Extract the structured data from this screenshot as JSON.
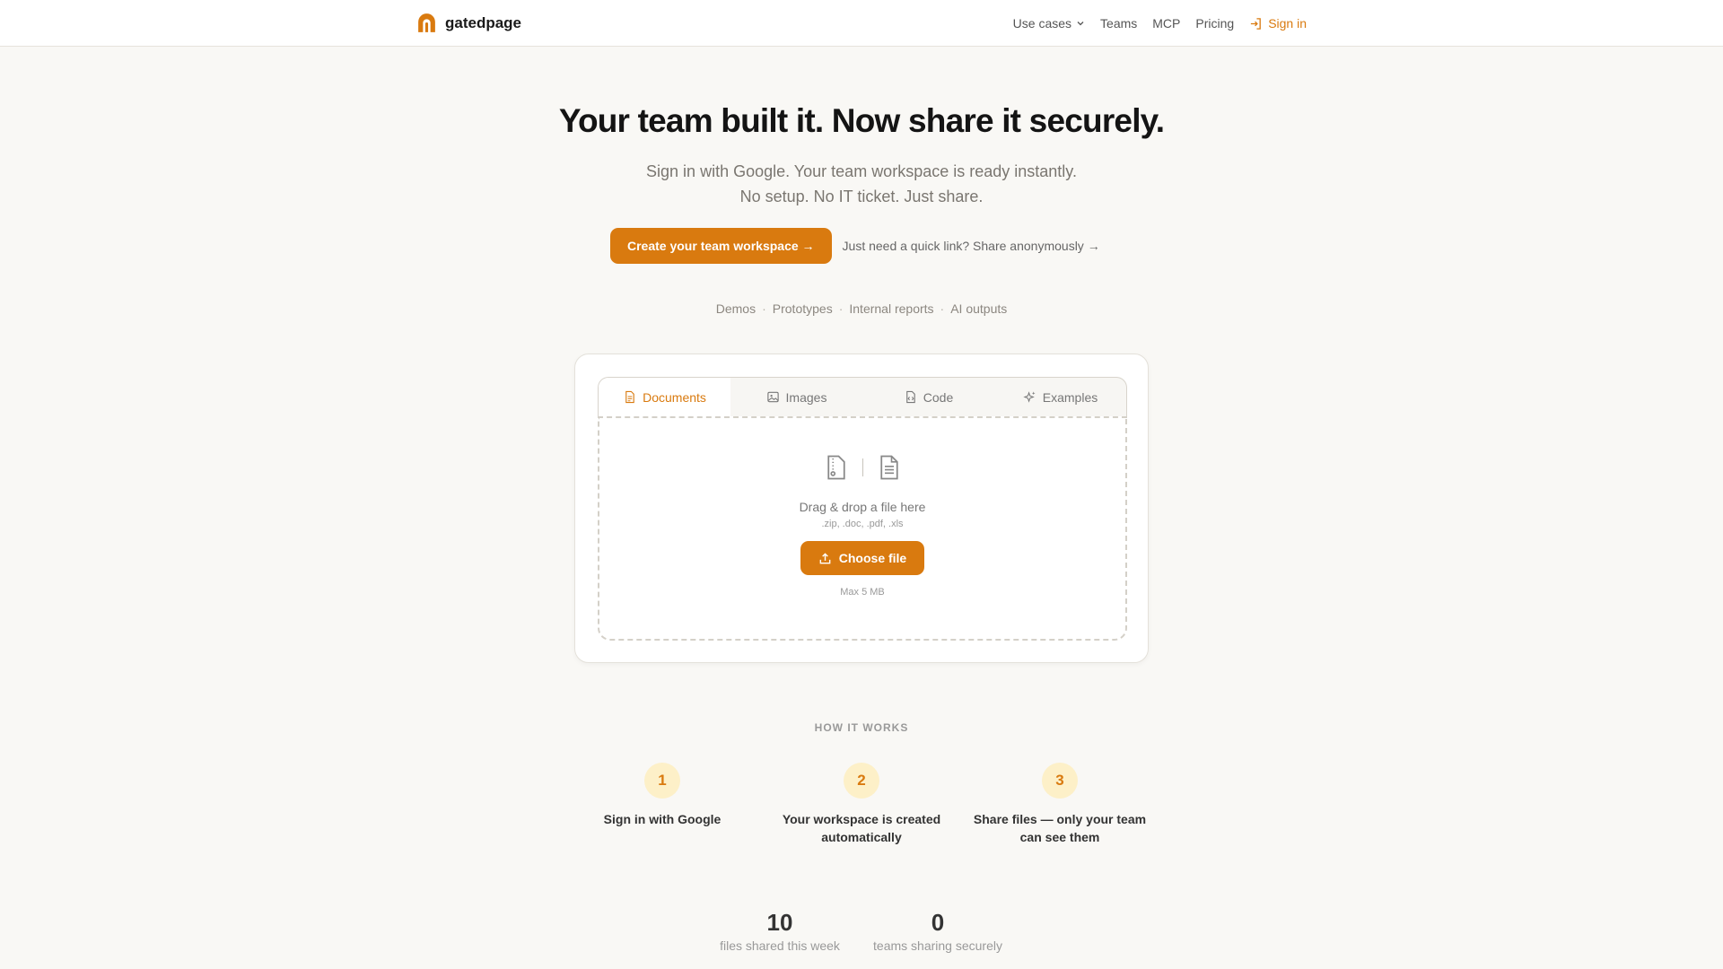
{
  "brand": {
    "name": "gatedpage"
  },
  "nav": {
    "use_cases": "Use cases",
    "teams": "Teams",
    "mcp": "MCP",
    "pricing": "Pricing",
    "sign_in": "Sign in"
  },
  "hero": {
    "title": "Your team built it. Now share it securely.",
    "subtitle_1": "Sign in with Google. Your team workspace is ready instantly.",
    "subtitle_2": "No setup. No IT ticket. Just share.",
    "cta_primary": "Create your team workspace →",
    "cta_secondary": "Just need a quick link? Share anonymously →",
    "tags": [
      "Demos",
      "Prototypes",
      "Internal reports",
      "AI outputs"
    ]
  },
  "upload": {
    "tabs": [
      {
        "label": "Documents",
        "icon": "document-icon",
        "active": true
      },
      {
        "label": "Images",
        "icon": "image-icon",
        "active": false
      },
      {
        "label": "Code",
        "icon": "code-file-icon",
        "active": false
      },
      {
        "label": "Examples",
        "icon": "sparkles-icon",
        "active": false
      }
    ],
    "drop_text": "Drag & drop a file here",
    "file_types": ".zip, .doc, .pdf, .xls",
    "choose_label": "Choose file",
    "max_size": "Max 5 MB"
  },
  "how": {
    "title": "HOW IT WORKS",
    "steps": [
      {
        "num": "1",
        "text": "Sign in with Google"
      },
      {
        "num": "2",
        "text": "Your workspace is created automatically"
      },
      {
        "num": "3",
        "text": "Share files — only your team can see them"
      }
    ]
  },
  "stats": [
    {
      "value": "10",
      "label": "files shared this week"
    },
    {
      "value": "0",
      "label": "teams sharing securely"
    }
  ],
  "colors": {
    "accent": "#d97a0f",
    "background": "#f9f8f5",
    "step_bg": "#fdf0c8"
  }
}
